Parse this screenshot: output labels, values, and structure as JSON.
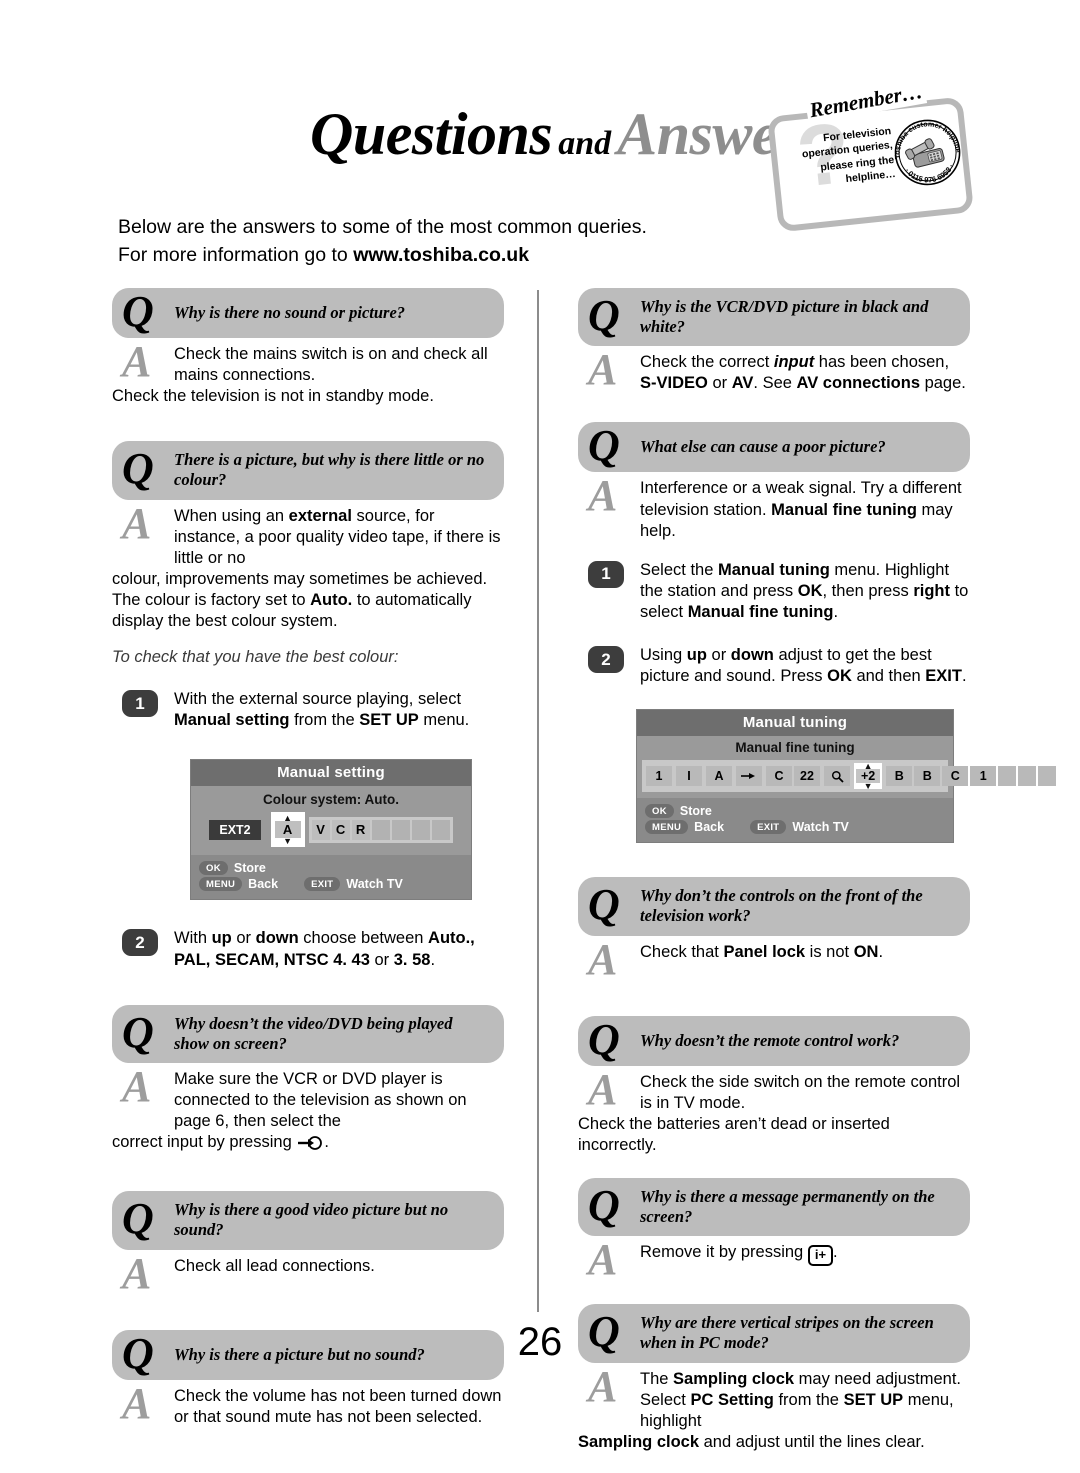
{
  "header": {
    "title_q": "Questions",
    "title_and": "and",
    "title_a": "Answers"
  },
  "remember_badge": {
    "remember_label": "Remember…",
    "question_mark": "?",
    "body_text": "For television operation queries, please ring the helpline…",
    "stamp_top_text": "Toshiba customer helpline",
    "stamp_bottom_text": "· 0115 976 6958 ·",
    "phone_icon": "telephone-icon"
  },
  "intro": {
    "line1": "Below are the answers to some of the most common queries.",
    "line2_prefix": "For more information go to ",
    "line2_url": "www.toshiba.co.uk"
  },
  "left_column": {
    "q1": {
      "q_letter": "Q",
      "question": "Why is there no sound or picture?",
      "a_letter": "A",
      "answer": "Check the mains switch is on and check all mains connections.",
      "answer_overflow": "Check the television is not in standby mode."
    },
    "q2": {
      "q_letter": "Q",
      "question": "There is a picture, but why is there little or no colour?",
      "a_letter": "A",
      "answer_part1": "When using an ",
      "answer_bold1": "external",
      "answer_part2": " source, for instance, a poor quality video tape, if there is little or no",
      "answer_overflow_part1": "colour, improvements may sometimes be achieved. The colour is factory set to ",
      "answer_overflow_bold": "Auto.",
      "answer_overflow_part2": " to automatically display the best colour system.",
      "note": "To check that you have the best colour:",
      "step1_num": "1",
      "step1_part1": "With the external source playing, select ",
      "step1_bold1": "Manual setting",
      "step1_part2": " from the ",
      "step1_bold2": "SET UP",
      "step1_part3": " menu.",
      "step2_num": "2",
      "step2_part1": "With ",
      "step2_bold1": "up",
      "step2_part2": " or ",
      "step2_bold2": "down",
      "step2_part3": " choose between ",
      "step2_bold3": "Auto., PAL, SECAM, NTSC 4. 43",
      "step2_part4": " or ",
      "step2_bold4": "3. 58",
      "step2_part5": "."
    },
    "osd_manual_setting": {
      "title": "Manual setting",
      "subtitle": "Colour system: Auto.",
      "source_chip": "EXT2",
      "selected_value": "A",
      "up_arrow": "▲",
      "down_arrow": "▼",
      "cells": [
        "V",
        "C",
        "R",
        "",
        "",
        "",
        ""
      ],
      "footer_ok_key": "OK",
      "footer_ok_label": "Store",
      "footer_menu_key": "MENU",
      "footer_menu_label": "Back",
      "footer_exit_key": "EXIT",
      "footer_exit_label": "Watch TV"
    },
    "q3": {
      "q_letter": "Q",
      "question": "Why doesn’t the video/DVD being played show on screen?",
      "a_letter": "A",
      "answer": "Make sure the VCR or DVD player is connected to the television as shown on page 6, then select the",
      "answer_overflow_prefix": "correct input by pressing ",
      "answer_overflow_icon": "input-select-icon",
      "answer_overflow_suffix": "."
    },
    "q4": {
      "q_letter": "Q",
      "question": "Why is there a good video picture but no sound?",
      "a_letter": "A",
      "answer": "Check all lead connections."
    },
    "q5": {
      "q_letter": "Q",
      "question": "Why is there a picture but no sound?",
      "a_letter": "A",
      "answer": "Check the volume has not been turned down or that sound mute has not been selected."
    }
  },
  "right_column": {
    "q1": {
      "q_letter": "Q",
      "question": "Why is the VCR/DVD picture in black and white?",
      "a_letter": "A",
      "answer_part1": "Check the correct ",
      "answer_italic": "input",
      "answer_part2": " has been chosen,",
      "answer_line2_bold1": "S-VIDEO",
      "answer_line2_part1": " or ",
      "answer_line2_bold2": "AV",
      "answer_line2_part2": ". See ",
      "answer_line2_bold3": "AV connections",
      "answer_line2_part3": " page."
    },
    "q2": {
      "q_letter": "Q",
      "question": "What else can cause a poor picture?",
      "a_letter": "A",
      "answer_part1": "Interference or a weak signal. Try a different television station. ",
      "answer_bold": "Manual fine tuning",
      "answer_part2": " may help.",
      "step1_num": "1",
      "step1_part1": "Select the ",
      "step1_bold1": "Manual tuning",
      "step1_part2": " menu. Highlight the station and press ",
      "step1_bold2": "OK",
      "step1_part3": ", then press ",
      "step1_bold3": "right",
      "step1_part4": " to select ",
      "step1_bold4": "Manual fine tuning",
      "step1_part5": ".",
      "step2_num": "2",
      "step2_part1": "Using ",
      "step2_bold1": "up",
      "step2_part2": " or ",
      "step2_bold2": "down",
      "step2_part3": " adjust to get the best picture and sound. Press ",
      "step2_bold3": "OK",
      "step2_part4": " and then ",
      "step2_bold4": "EXIT",
      "step2_part5": "."
    },
    "osd_manual_tuning": {
      "title": "Manual tuning",
      "subtitle": "Manual fine tuning",
      "cells": [
        "1",
        "I",
        "A"
      ],
      "arrow_icon": "right-arrow-icon",
      "channel_prefix": "C",
      "channel_number": "22",
      "search_icon": "magnifier-icon",
      "selected_value": "+2",
      "up_arrow": "▲",
      "down_arrow": "▼",
      "name_cells": [
        "B",
        "B",
        "C",
        "1"
      ],
      "blank_cells": 3,
      "footer_ok_key": "OK",
      "footer_ok_label": "Store",
      "footer_menu_key": "MENU",
      "footer_menu_label": "Back",
      "footer_exit_key": "EXIT",
      "footer_exit_label": "Watch TV"
    },
    "q3": {
      "q_letter": "Q",
      "question": "Why don’t the controls on the front of the television work?",
      "a_letter": "A",
      "answer_part1": "Check that ",
      "answer_bold1": "Panel lock",
      "answer_part2": " is not ",
      "answer_bold2": "ON",
      "answer_part3": "."
    },
    "q4": {
      "q_letter": "Q",
      "question": "Why doesn’t the remote control work?",
      "a_letter": "A",
      "answer": "Check the side switch on the remote control is in TV mode.",
      "answer_overflow": "Check the batteries aren’t dead or inserted incorrectly."
    },
    "q5": {
      "q_letter": "Q",
      "question": "Why is there a message permanently on the screen?",
      "a_letter": "A",
      "answer_prefix": "Remove it by pressing ",
      "answer_key": "i+",
      "answer_suffix": "."
    },
    "q6": {
      "q_letter": "Q",
      "question": "Why are there vertical stripes on the screen when in PC mode?",
      "a_letter": "A",
      "answer_part1": "The ",
      "answer_bold1": "Sampling clock",
      "answer_part2": " may need adjustment. Select ",
      "answer_bold2": "PC Setting",
      "answer_part3": " from the ",
      "answer_bold3": "SET UP",
      "answer_part4": " menu, highlight",
      "answer_overflow_bold": "Sampling clock",
      "answer_overflow_part": " and adjust until the lines clear."
    }
  },
  "footer": {
    "page_number": "26"
  },
  "colors": {
    "q_bar_bg": "#bcbcbc",
    "a_letter": "#9d9d9d",
    "step_badge": "#3d3d3d",
    "osd_title_bg": "#6e6e6e",
    "osd_body_bg": "#9a9a9a",
    "divider": "#8c8c8c"
  }
}
